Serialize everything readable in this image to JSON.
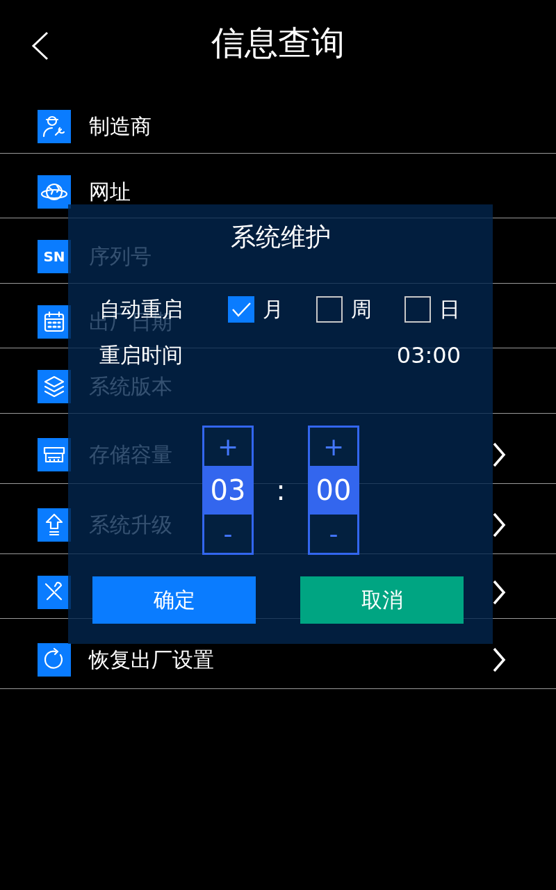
{
  "header": {
    "title": "信息查询"
  },
  "menu": [
    {
      "label": "制造商",
      "chevron": false
    },
    {
      "label": "网址",
      "chevron": false
    },
    {
      "label": "序列号",
      "icon_text": "SN",
      "chevron": false
    },
    {
      "label": "出厂日期",
      "chevron": false
    },
    {
      "label": "系统版本",
      "chevron": false
    },
    {
      "label": "存储容量",
      "chevron": true
    },
    {
      "label": "系统升级",
      "chevron": true
    },
    {
      "chevron": true
    },
    {
      "label": "恢复出厂设置",
      "chevron": true
    }
  ],
  "dialog": {
    "title": "系统维护",
    "auto_restart": {
      "label": "自动重启",
      "options": [
        {
          "label": "月",
          "checked": true
        },
        {
          "label": "周",
          "checked": false
        },
        {
          "label": "日",
          "checked": false
        }
      ]
    },
    "restart_time": {
      "label": "重启时间",
      "value": "03:00"
    },
    "spinners": [
      {
        "plus": "+",
        "value": "03",
        "minus": "-"
      },
      {
        "plus": "+",
        "value": "00",
        "minus": "-"
      }
    ],
    "separator": ":",
    "buttons": [
      {
        "label": "确定",
        "kind": "primary"
      },
      {
        "label": "取消",
        "kind": "secondary"
      }
    ]
  }
}
